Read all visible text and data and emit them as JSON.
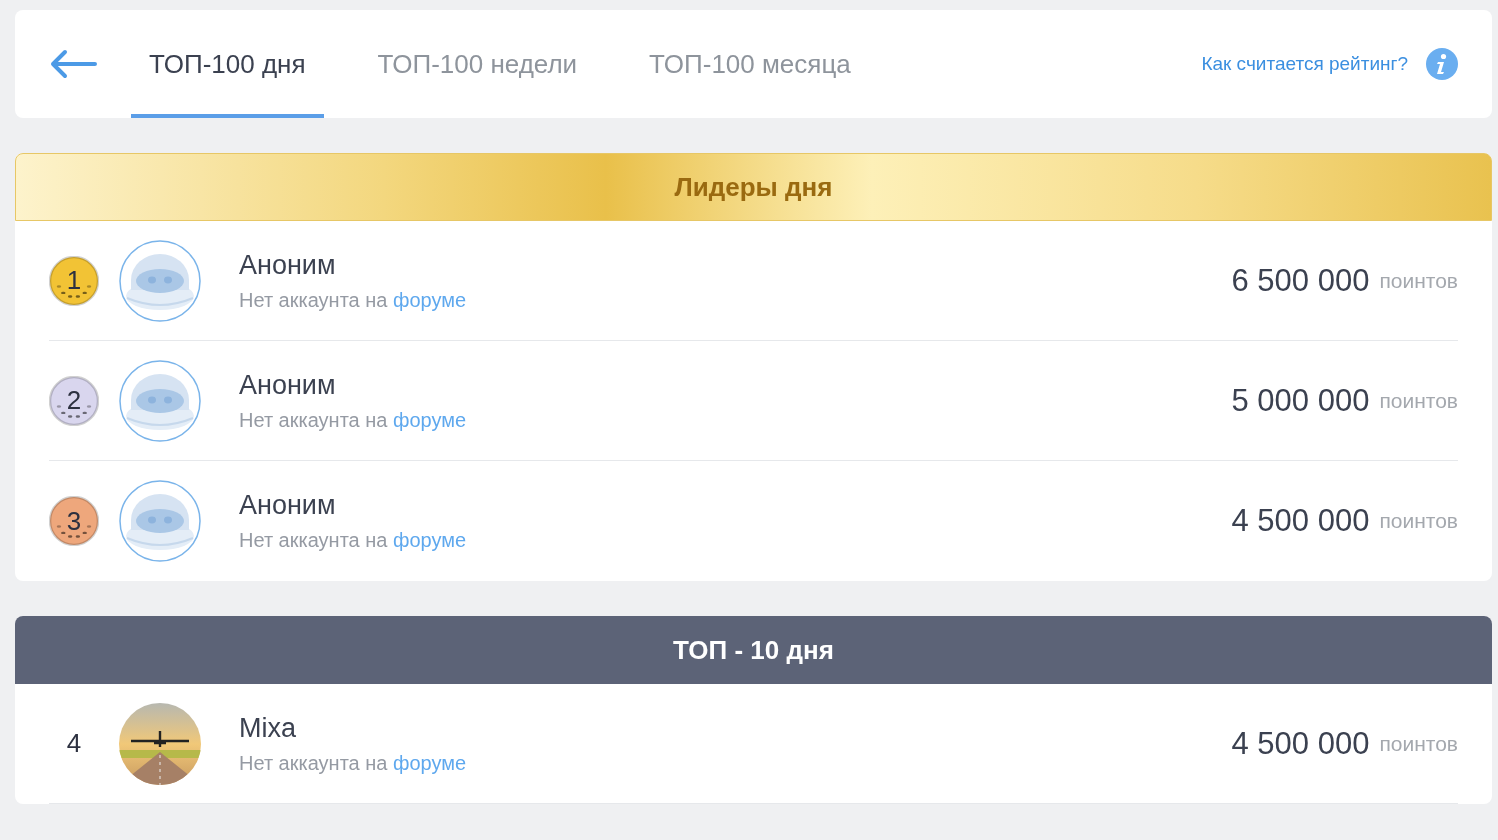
{
  "tabs": [
    {
      "label": "ТОП-100 дня",
      "selected": true
    },
    {
      "label": "ТОП-100 недели",
      "selected": false
    },
    {
      "label": "ТОП-100 месяца",
      "selected": false
    }
  ],
  "help_link": "Как считается рейтинг?",
  "sections": [
    {
      "kind": "leaders",
      "title": "Лидеры дня",
      "rows": [
        {
          "rank": "1",
          "color": "#f2c335",
          "kind": "robot",
          "name": "Аноним",
          "note": "Нет аккаунта на",
          "link": "форуме",
          "points": "6 500 000",
          "unit": "поинтов"
        },
        {
          "rank": "2",
          "color": "#d9d6ee",
          "kind": "robot",
          "name": "Аноним",
          "note": "Нет аккаунта на",
          "link": "форуме",
          "points": "5 000 000",
          "unit": "поинтов"
        },
        {
          "rank": "3",
          "color": "#eea77c",
          "kind": "robot",
          "name": "Аноним",
          "note": "Нет аккаунта на",
          "link": "форуме",
          "points": "4 500 000",
          "unit": "поинтов"
        }
      ]
    },
    {
      "kind": "top",
      "title": "ТОП - 10 дня",
      "rows": [
        {
          "rank": "4",
          "kind": "photo",
          "name": "Mixa",
          "note": "Нет аккаунта на",
          "link": "форуме",
          "points": "4 500 000",
          "unit": "поинтов"
        }
      ]
    }
  ]
}
